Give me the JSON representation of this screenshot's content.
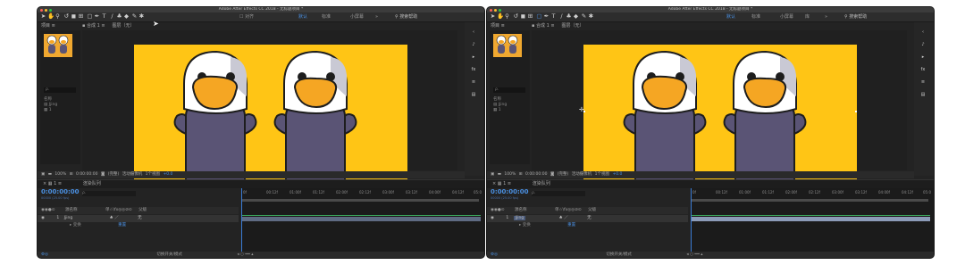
{
  "app": {
    "title": "Adobe After Effects CC 2018 - 无标题项目 *",
    "traffic_light_colors": [
      "#ff5f56",
      "#ffbd2e",
      "#27c93f"
    ]
  },
  "toolbar": {
    "tool_icons": [
      "selection-tool-icon",
      "hand-tool-icon",
      "zoom-tool-icon",
      "rotate-tool-icon",
      "camera-tool-icon",
      "pan-behind-icon",
      "mask-tool-icon",
      "pen-tool-icon",
      "type-tool-icon",
      "brush-tool-icon",
      "clone-stamp-icon",
      "eraser-icon",
      "roto-brush-icon",
      "puppet-pin-icon"
    ],
    "align_label": "对齐",
    "workspaces": [
      "默认",
      "标准",
      "小屏幕",
      "库"
    ],
    "active_workspace": "默认",
    "more": "»",
    "search_help": "搜索帮助"
  },
  "project_panel": {
    "tab_label": "项目",
    "search_placeholder": "ρ.",
    "column_name": "名称",
    "items": [
      "Jjing",
      "1"
    ]
  },
  "comp_panel": {
    "tab_label": "合成",
    "comp_name": "1",
    "layer_tab": "图层（无）"
  },
  "viewer_bar": {
    "zoom": "100%",
    "timecode": "0:00:00:00",
    "resolution": "(完整)",
    "camera": "活动摄像机",
    "views": "1个视图",
    "exposure": "+0.0"
  },
  "timeline": {
    "tab_label": "渲染队列",
    "comp_tab": "1",
    "timecode": "0:00:00:00",
    "fps_note": "00000 (25.00 fps)",
    "search_placeholder": "ρ.",
    "header_source": "源名称",
    "header_switches": "单☆\\fx◎◎⊘⊙",
    "header_parent": "父级",
    "layer_name": "Jjing",
    "layer_index": "1",
    "parent_value": "无",
    "sub_row": "变换",
    "sub_reset": "重置",
    "ruler_ticks": [
      "0f",
      "00:12f",
      "01:00f",
      "01:12f",
      "02:00f",
      "02:12f",
      "03:00f",
      "03:12f",
      "04:00f",
      "04:12f",
      "05:0"
    ],
    "bottom_toggle": "切换开关/模式"
  },
  "illustration": {
    "bg_color": "#ffc515",
    "bird_body_color": "#5a5475",
    "beak_color": "#f5a623",
    "outline_color": "#1d1d1d"
  }
}
